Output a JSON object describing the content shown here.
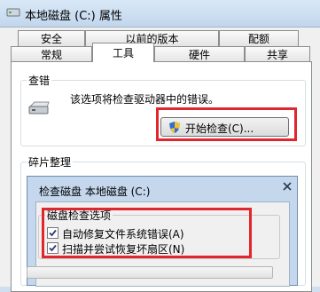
{
  "window": {
    "title": "本地磁盘 (C:) 属性"
  },
  "tabs_back": [
    "安全",
    "以前的版本",
    "配额"
  ],
  "tabs_front": [
    "常规",
    "工具",
    "硬件",
    "共享"
  ],
  "active_tab": "工具",
  "error_check": {
    "group_title": "查错",
    "description": "该选项将检查驱动器中的错误。",
    "button_label": "开始检查(C)..."
  },
  "defrag": {
    "group_title": "碎片整理"
  },
  "dialog": {
    "title": "检查磁盘 本地磁盘 (C:)",
    "options_title": "磁盘检查选项",
    "options": [
      {
        "label": "自动修复文件系统错误(A)",
        "checked": true
      },
      {
        "label": "扫描并尝试恢复坏扇区(N)",
        "checked": true
      }
    ]
  },
  "highlight_color": "#e2262d"
}
